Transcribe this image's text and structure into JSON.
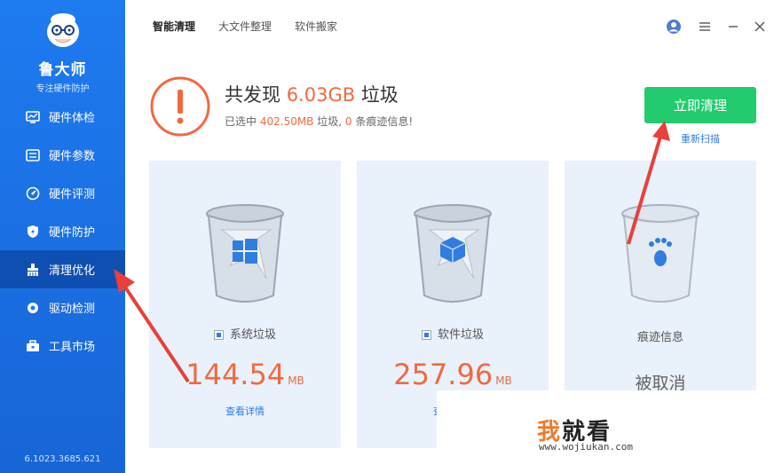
{
  "sidebar": {
    "app_name": "鲁大师",
    "slogan": "专注硬件防护",
    "version": "6.1023.3685.621",
    "items": [
      {
        "label": "硬件体检",
        "icon": "monitor-icon"
      },
      {
        "label": "硬件参数",
        "icon": "list-icon"
      },
      {
        "label": "硬件评测",
        "icon": "gauge-icon"
      },
      {
        "label": "硬件防护",
        "icon": "shield-icon"
      },
      {
        "label": "清理优化",
        "icon": "broom-icon",
        "active": true
      },
      {
        "label": "驱动检测",
        "icon": "gear-icon"
      },
      {
        "label": "工具市场",
        "icon": "toolbox-icon"
      }
    ]
  },
  "tabs": [
    {
      "label": "智能清理",
      "active": true
    },
    {
      "label": "大文件整理"
    },
    {
      "label": "软件搬家"
    }
  ],
  "summary": {
    "title_prefix": "共发现",
    "total_size": "6.03GB",
    "title_suffix": "垃圾",
    "sub_prefix": "已选中",
    "selected_size": "402.50MB",
    "sub_mid": "垃圾,",
    "trace_count": "0",
    "sub_suffix": "条痕迹信息!"
  },
  "actions": {
    "clean_label": "立即清理",
    "rescan_label": "重新扫描"
  },
  "cards": [
    {
      "label": "系统垃圾",
      "size": "144.54",
      "unit": "MB",
      "detail": "查看详情",
      "checked": true
    },
    {
      "label": "软件垃圾",
      "size": "257.96",
      "unit": "MB",
      "detail": "查看详情",
      "checked": true
    },
    {
      "label": "痕迹信息",
      "status": "被取消",
      "checked": false
    }
  ],
  "watermark": {
    "text_1": "我",
    "text_2": "就看",
    "url": "www.wojiukan.com"
  },
  "colors": {
    "sidebar": "#1e7bf0",
    "accent_orange": "#f06a3f",
    "clean_button": "#22cc6e",
    "link_blue": "#2e7ce8",
    "card_bg": "#e9f1fb",
    "arrow_red": "#e8403a"
  }
}
